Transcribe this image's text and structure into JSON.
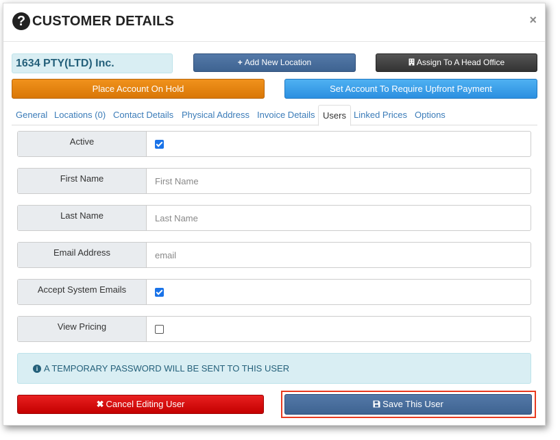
{
  "header": {
    "help_icon": "?",
    "title": "CUSTOMER DETAILS",
    "close_icon": "×"
  },
  "company_name": "1634 PTY(LTD) Inc.",
  "actions": {
    "add_location_icon": "+",
    "add_location": "Add New Location",
    "head_office_icon": "building-icon",
    "head_office": "Assign To A Head Office",
    "place_on_hold": "Place Account On Hold",
    "require_upfront": "Set Account To Require Upfront Payment"
  },
  "tabs": [
    {
      "label": "General"
    },
    {
      "label": "Locations (0)"
    },
    {
      "label": "Contact Details"
    },
    {
      "label": "Physical Address"
    },
    {
      "label": "Invoice Details"
    },
    {
      "label": "Users",
      "active": true
    },
    {
      "label": "Linked Prices"
    },
    {
      "label": "Options"
    }
  ],
  "user_form": {
    "active_label": "Active",
    "active_checked": true,
    "first_name_label": "First Name",
    "first_name_placeholder": "First Name",
    "first_name_value": "",
    "last_name_label": "Last Name",
    "last_name_placeholder": "Last Name",
    "last_name_value": "",
    "email_label": "Email Address",
    "email_placeholder": "email",
    "email_value": "",
    "accept_emails_label": "Accept System Emails",
    "accept_emails_checked": true,
    "view_pricing_label": "View Pricing",
    "view_pricing_checked": false
  },
  "info": {
    "icon": "i",
    "message": "A TEMPORARY PASSWORD WILL BE SENT TO THIS USER"
  },
  "footer": {
    "cancel_icon": "✖",
    "cancel": "Cancel Editing User",
    "save_icon": "floppy-disk-icon",
    "save": "Save This User"
  },
  "colors": {
    "primary_blue": "#4a6f9d",
    "dark": "#444444",
    "orange": "#e88511",
    "light_blue": "#3a9ef0",
    "red": "#d90e0e",
    "info_bg": "#d9eef3",
    "highlight_outline": "#e8391e"
  }
}
